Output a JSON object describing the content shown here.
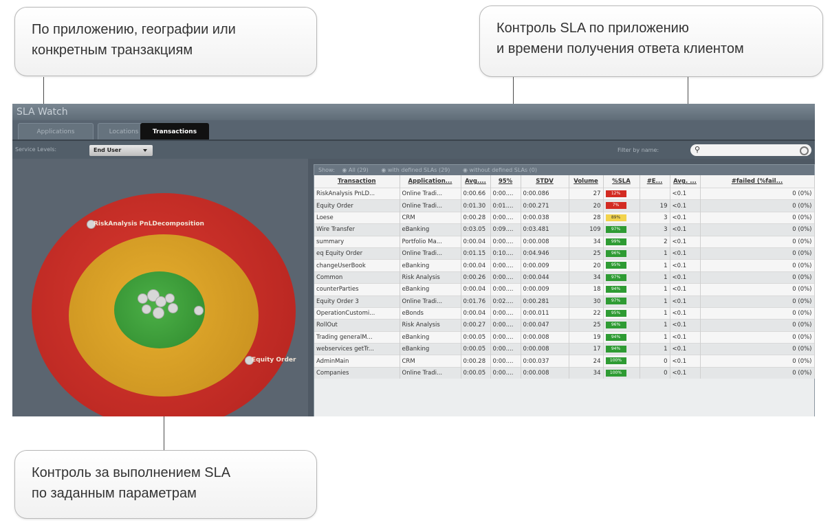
{
  "callouts": {
    "top_left": {
      "line1": "По приложению, географии или",
      "line2": "конкретным транзакциям"
    },
    "top_right": {
      "line1": "Контроль SLA по приложению",
      "line2": "и времени получения ответа клиентом"
    },
    "bottom_left": {
      "line1": "Контроль за выполнением SLA",
      "line2": "по заданным параметрам"
    }
  },
  "app": {
    "title": "SLA Watch",
    "tabs": [
      {
        "label": "Applications",
        "active": false
      },
      {
        "label": "Locations",
        "active": false
      },
      {
        "label": "Transactions",
        "active": true
      }
    ],
    "service_levels_label": "Service Levels:",
    "service_levels_value": "End User",
    "filter_label": "Filter by name:",
    "filter_value": ""
  },
  "viz": {
    "label_top": "RiskAnalysis PnLDecomposition",
    "label_right": "Equity Order",
    "colors": {
      "red": "#cc2f2a",
      "amber": "#dba024",
      "green": "#3d9a3a"
    }
  },
  "table": {
    "show_label": "Show:",
    "filters": [
      "All (29)",
      "with defined SLAs (29)",
      "without defined SLAs (0)"
    ],
    "columns": [
      "Transaction",
      "Application...",
      "Avg....",
      "95%",
      "STDV",
      "Volume",
      "%SLA",
      "#E...",
      "Avg. ...",
      "#failed (%fail..."
    ],
    "rows": [
      [
        "RiskAnalysis PnLD...",
        "Online Tradi...",
        "0:00.66",
        "0:00....",
        "0:00.086",
        "27",
        "12%",
        "",
        "<0.1",
        "0 (0%)"
      ],
      [
        "Equity Order",
        "Online Tradi...",
        "0:01.30",
        "0:01....",
        "0:00.271",
        "20",
        "7%",
        "19",
        "<0.1",
        "0 (0%)"
      ],
      [
        "Loese",
        "CRM",
        "0:00.28",
        "0:00....",
        "0:00.038",
        "28",
        "89%",
        "3",
        "<0.1",
        "0 (0%)"
      ],
      [
        "Wire Transfer",
        "eBanking",
        "0:03.05",
        "0:09....",
        "0:03.481",
        "109",
        "97%",
        "3",
        "<0.1",
        "0 (0%)"
      ],
      [
        "summary",
        "Portfolio Ma...",
        "0:00.04",
        "0:00....",
        "0:00.008",
        "34",
        "99%",
        "2",
        "<0.1",
        "0 (0%)"
      ],
      [
        "eq Equity Order",
        "Online Tradi...",
        "0:01.15",
        "0:10....",
        "0:04.946",
        "25",
        "96%",
        "1",
        "<0.1",
        "0 (0%)"
      ],
      [
        "changeUserBook",
        "eBanking",
        "0:00.04",
        "0:00....",
        "0:00.009",
        "20",
        "95%",
        "1",
        "<0.1",
        "0 (0%)"
      ],
      [
        "Common",
        "Risk Analysis",
        "0:00.26",
        "0:00....",
        "0:00.044",
        "34",
        "97%",
        "1",
        "<0.1",
        "0 (0%)"
      ],
      [
        "counterParties",
        "eBanking",
        "0:00.04",
        "0:00....",
        "0:00.009",
        "18",
        "94%",
        "1",
        "<0.1",
        "0 (0%)"
      ],
      [
        "Equity Order 3",
        "Online Tradi...",
        "0:01.76",
        "0:02....",
        "0:00.281",
        "30",
        "97%",
        "1",
        "<0.1",
        "0 (0%)"
      ],
      [
        "OperationCustomi...",
        "eBonds",
        "0:00.04",
        "0:00....",
        "0:00.011",
        "22",
        "95%",
        "1",
        "<0.1",
        "0 (0%)"
      ],
      [
        "RollOut",
        "Risk Analysis",
        "0:00.27",
        "0:00....",
        "0:00.047",
        "25",
        "96%",
        "1",
        "<0.1",
        "0 (0%)"
      ],
      [
        "Trading generalM...",
        "eBanking",
        "0:00.05",
        "0:00....",
        "0:00.008",
        "19",
        "94%",
        "1",
        "<0.1",
        "0 (0%)"
      ],
      [
        "webservices getTr...",
        "eBanking",
        "0:00.05",
        "0:00....",
        "0:00.008",
        "17",
        "94%",
        "1",
        "<0.1",
        "0 (0%)"
      ],
      [
        "AdminMain",
        "CRM",
        "0:00.28",
        "0:00....",
        "0:00.037",
        "24",
        "100%",
        "0",
        "<0.1",
        "0 (0%)"
      ],
      [
        "Companies",
        "Online Tradi...",
        "0:00.05",
        "0:00....",
        "0:00.008",
        "34",
        "100%",
        "0",
        "<0.1",
        "0 (0%)"
      ]
    ],
    "sla_colors": [
      "#d32b22",
      "#d32b22",
      "#f2d34c",
      "#2e9b33",
      "#2e9b33",
      "#2e9b33",
      "#2e9b33",
      "#2e9b33",
      "#2e9b33",
      "#2e9b33",
      "#2e9b33",
      "#2e9b33",
      "#2e9b33",
      "#2e9b33",
      "#2e9b33",
      "#2e9b33"
    ]
  }
}
